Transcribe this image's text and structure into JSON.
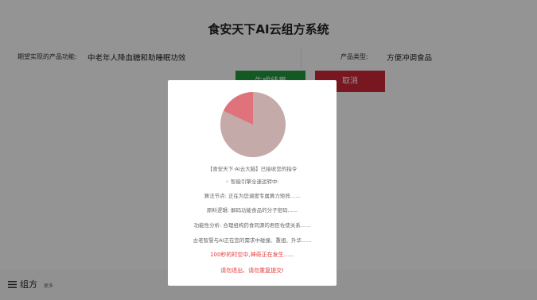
{
  "app": {
    "title": "食安天下AI云组方系统"
  },
  "form": {
    "function_label": "期望实现的产品功能:",
    "function_value": "中老年人降血糖和助睡眠功效",
    "type_label": "产品类型:",
    "type_value": "方便冲调食品",
    "submit_label": "生成结果",
    "cancel_label": "取消"
  },
  "footer": {
    "menu_label": "组方",
    "sub_label": "更多"
  },
  "modal": {
    "progress": 0.18,
    "lines": [
      "【食安天下·AI云大脑】已接收您的指令",
      "智能引擎全速运转中:",
      "算法节点: 正在为您调度专属算力矩阵......",
      "原料逻辑: 解码功能食品的分子密码......",
      "功能性分析: 合理组构药食同源的君臣佐使关系......",
      "古老智慧与AI正在您的需求中碰撞、重组、升华......"
    ],
    "warn1": "100秒的时空中,神奇正在发生......",
    "warn2": "请勿退出、请勿重复提交!"
  },
  "colors": {
    "green": "#1f9a3e",
    "red": "#d0283a",
    "pie_bg": "#c4aaa8",
    "pie_slice": "#e0727c",
    "warn": "#e23a3a"
  }
}
